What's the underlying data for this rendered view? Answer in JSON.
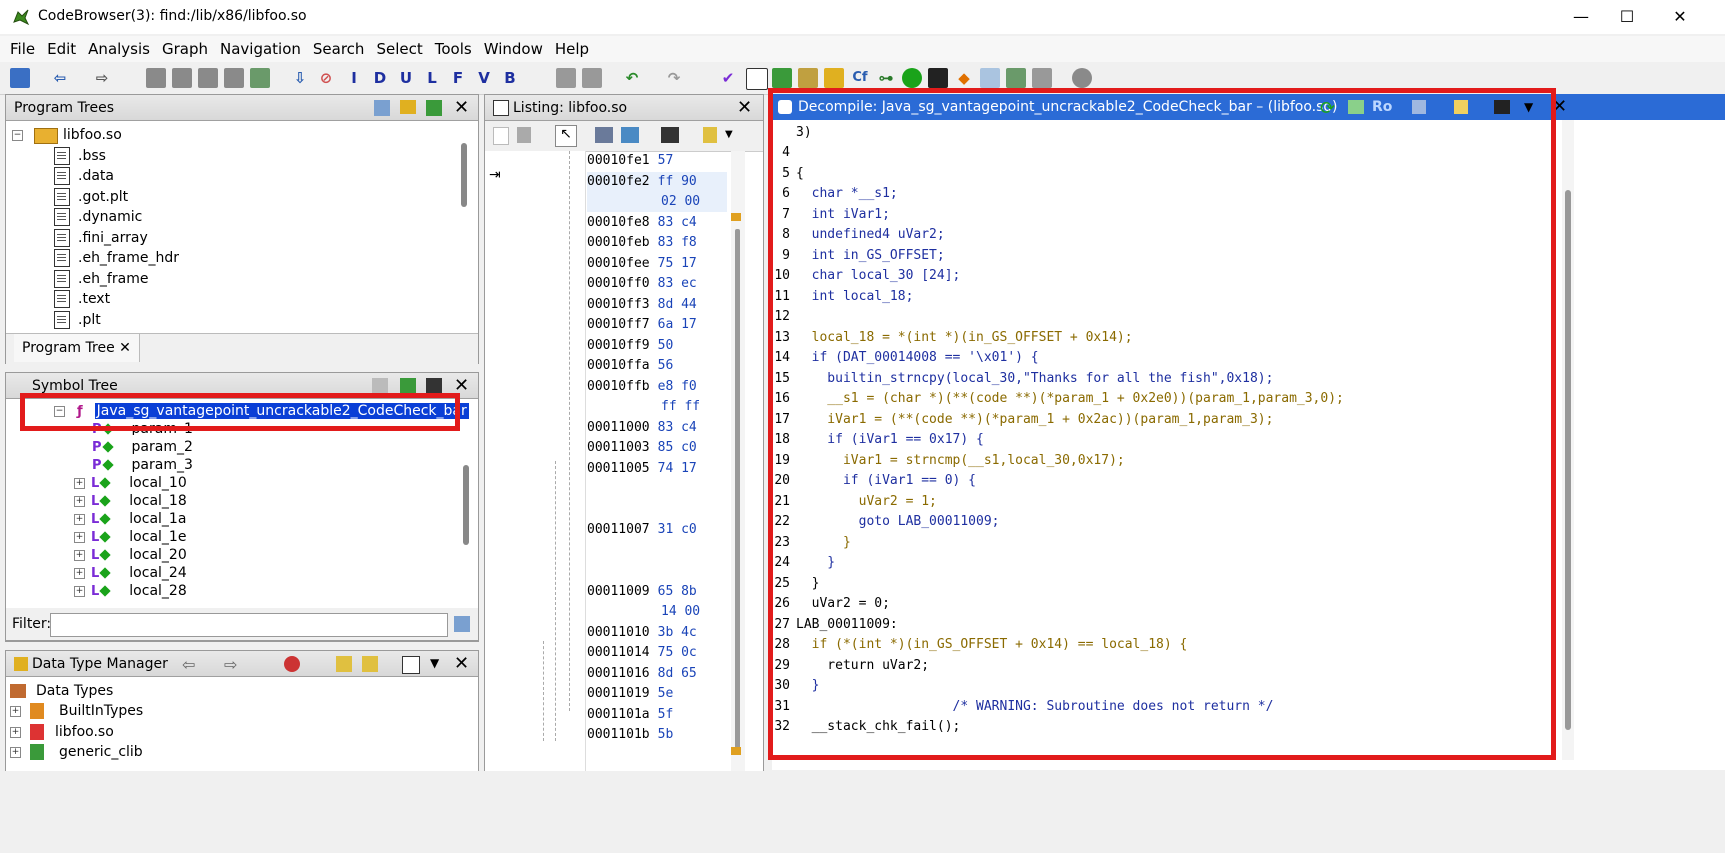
{
  "window": {
    "title": "CodeBrowser(3): find:/lib/x86/libfoo.so",
    "minimize": "—",
    "maximize": "☐",
    "close": "✕"
  },
  "menu": [
    "File",
    "Edit",
    "Analysis",
    "Graph",
    "Navigation",
    "Search",
    "Select",
    "Tools",
    "Window",
    "Help"
  ],
  "program_trees": {
    "title": "Program Trees",
    "root": "libfoo.so",
    "items": [
      ".bss",
      ".data",
      ".got.plt",
      ".dynamic",
      ".fini_array",
      ".eh_frame_hdr",
      ".eh_frame",
      ".text",
      ".plt"
    ],
    "tab": "Program Tree"
  },
  "symbol_tree": {
    "title": "Symbol Tree",
    "function": "Java_sg_vantagepoint_uncrackable2_CodeCheck_bar",
    "params": [
      "param_1",
      "param_2",
      "param_3"
    ],
    "locals": [
      "local_10",
      "local_18",
      "local_1a",
      "local_1e",
      "local_20",
      "local_24",
      "local_28"
    ]
  },
  "filter": {
    "label": "Filter:",
    "value": ""
  },
  "data_type_manager": {
    "title": "Data Type Manager",
    "root": "Data Types",
    "items": [
      "BuiltInTypes",
      "libfoo.so",
      "generic_clib"
    ]
  },
  "listing": {
    "title": "Listing:  libfoo.so",
    "rows": [
      {
        "addr": "00010fe1",
        "bytes": "57"
      },
      {
        "addr": "00010fe2",
        "bytes": "ff 90"
      },
      {
        "addr": "",
        "bytes": "02 00"
      },
      {
        "addr": "00010fe8",
        "bytes": "83 c4"
      },
      {
        "addr": "00010feb",
        "bytes": "83 f8"
      },
      {
        "addr": "00010fee",
        "bytes": "75 17"
      },
      {
        "addr": "00010ff0",
        "bytes": "83 ec"
      },
      {
        "addr": "00010ff3",
        "bytes": "8d 44"
      },
      {
        "addr": "00010ff7",
        "bytes": "6a 17"
      },
      {
        "addr": "00010ff9",
        "bytes": "50"
      },
      {
        "addr": "00010ffa",
        "bytes": "56"
      },
      {
        "addr": "00010ffb",
        "bytes": "e8 f0"
      },
      {
        "addr": "",
        "bytes": "ff ff"
      },
      {
        "addr": "00011000",
        "bytes": "83 c4"
      },
      {
        "addr": "00011003",
        "bytes": "85 c0"
      },
      {
        "addr": "00011005",
        "bytes": "74 17"
      },
      {
        "addr": "00011007",
        "bytes": "31 c0"
      },
      {
        "addr": "00011009",
        "bytes": "65 8b"
      },
      {
        "addr": "",
        "bytes": "14 00"
      },
      {
        "addr": "00011010",
        "bytes": "3b 4c"
      },
      {
        "addr": "00011014",
        "bytes": "75 0c"
      },
      {
        "addr": "00011016",
        "bytes": "8d 65"
      },
      {
        "addr": "00011019",
        "bytes": "5e"
      },
      {
        "addr": "0001101a",
        "bytes": "5f"
      },
      {
        "addr": "0001101b",
        "bytes": "5b"
      }
    ]
  },
  "decompile": {
    "title": "Decompile: Java_sg_vantagepoint_uncrackable2_CodeCheck_bar –  (libfoo.so)",
    "lines": [
      {
        "n": "",
        "t": "3)"
      },
      {
        "n": "4",
        "t": ""
      },
      {
        "n": "5",
        "t": "{"
      },
      {
        "n": "6",
        "t": "  char *__s1;"
      },
      {
        "n": "7",
        "t": "  int iVar1;"
      },
      {
        "n": "8",
        "t": "  undefined4 uVar2;"
      },
      {
        "n": "9",
        "t": "  int in_GS_OFFSET;"
      },
      {
        "n": "10",
        "t": "  char local_30 [24];"
      },
      {
        "n": "11",
        "t": "  int local_18;"
      },
      {
        "n": "12",
        "t": ""
      },
      {
        "n": "13",
        "t": "  local_18 = *(int *)(in_GS_OFFSET + 0x14);"
      },
      {
        "n": "14",
        "t": "  if (DAT_00014008 == '\\x01') {"
      },
      {
        "n": "15",
        "t": "    builtin_strncpy(local_30,\"Thanks for all the fish\",0x18);"
      },
      {
        "n": "16",
        "t": "    __s1 = (char *)(**(code **)(*param_1 + 0x2e0))(param_1,param_3,0);"
      },
      {
        "n": "17",
        "t": "    iVar1 = (**(code **)(*param_1 + 0x2ac))(param_1,param_3);"
      },
      {
        "n": "18",
        "t": "    if (iVar1 == 0x17) {"
      },
      {
        "n": "19",
        "t": "      iVar1 = strncmp(__s1,local_30,0x17);"
      },
      {
        "n": "20",
        "t": "      if (iVar1 == 0) {"
      },
      {
        "n": "21",
        "t": "        uVar2 = 1;"
      },
      {
        "n": "22",
        "t": "        goto LAB_00011009;"
      },
      {
        "n": "23",
        "t": "      }"
      },
      {
        "n": "24",
        "t": "    }"
      },
      {
        "n": "25",
        "t": "  }"
      },
      {
        "n": "26",
        "t": "  uVar2 = 0;"
      },
      {
        "n": "27",
        "t": "LAB_00011009:"
      },
      {
        "n": "28",
        "t": "  if (*(int *)(in_GS_OFFSET + 0x14) == local_18) {"
      },
      {
        "n": "29",
        "t": "    return uVar2;"
      },
      {
        "n": "30",
        "t": "  }"
      },
      {
        "n": "31",
        "t": "                    /* WARNING: Subroutine does not return */"
      },
      {
        "n": "32",
        "t": "  __stack_chk_fail();"
      }
    ]
  },
  "colors": {
    "highlight_box": "#e21b1b",
    "decompile_header": "#2b6bd6",
    "selection": "#0a3fd6"
  }
}
